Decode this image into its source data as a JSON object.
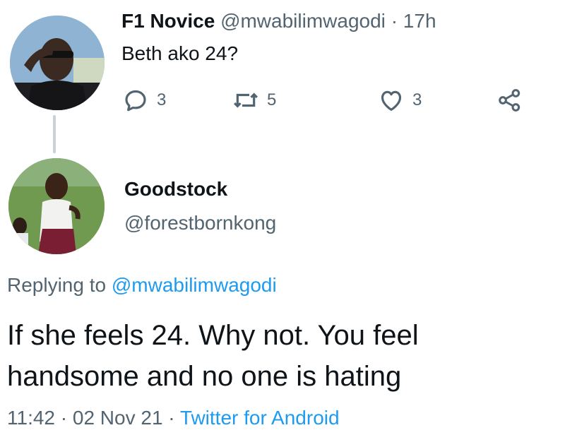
{
  "parent_tweet": {
    "author_name": "F1 Novice",
    "author_handle": "@mwabilimwagodi",
    "separator": "·",
    "time": "17h",
    "text": "Beth ako 24?",
    "reply_count": "3",
    "retweet_count": "5",
    "like_count": "3"
  },
  "reply_tweet": {
    "author_name": "Goodstock",
    "author_handle": "@forestbornkong",
    "replying_prefix": "Replying to",
    "replying_to": "@mwabilimwagodi",
    "text": "If she feels 24. Why not. You feel handsome and no one is hating",
    "timestamp": "11:42 · 02 Nov 21",
    "meta_separator": "·",
    "source": "Twitter for Android"
  },
  "icons": [
    "reply-icon",
    "retweet-icon",
    "like-icon",
    "share-icon"
  ],
  "colors": {
    "text": "#0f1419",
    "secondary": "#536471",
    "link": "#1d9bf0",
    "thread_line": "#c9d0d6"
  }
}
